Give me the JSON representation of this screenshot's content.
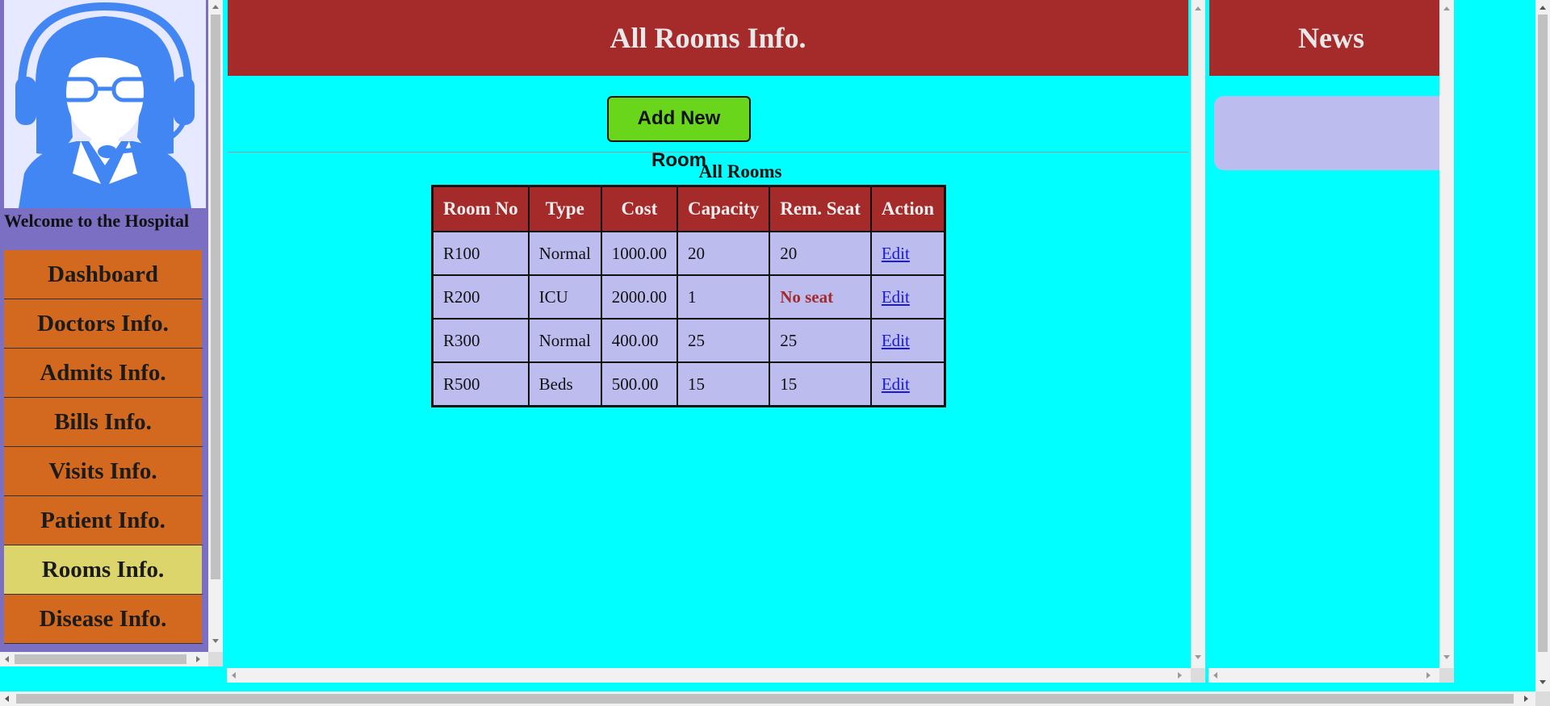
{
  "sidebar": {
    "welcome": "Welcome to the Hospital",
    "items": [
      {
        "label": "Dashboard",
        "active": false
      },
      {
        "label": "Doctors Info.",
        "active": false
      },
      {
        "label": "Admits Info.",
        "active": false
      },
      {
        "label": "Bills Info.",
        "active": false
      },
      {
        "label": "Visits Info.",
        "active": false
      },
      {
        "label": "Patient Info.",
        "active": false
      },
      {
        "label": "Rooms Info.",
        "active": true
      },
      {
        "label": "Disease Info.",
        "active": false
      }
    ]
  },
  "main": {
    "title": "All Rooms Info.",
    "add_button": "Add New Room",
    "table_caption": "All Rooms",
    "columns": [
      "Room No",
      "Type",
      "Cost",
      "Capacity",
      "Rem. Seat",
      "Action"
    ],
    "rows": [
      {
        "room": "R100",
        "type": "Normal",
        "cost": "1000.00",
        "capacity": "20",
        "seat": "20",
        "action": "Edit"
      },
      {
        "room": "R200",
        "type": "ICU",
        "cost": "2000.00",
        "capacity": "1",
        "seat": "No seat",
        "action": "Edit"
      },
      {
        "room": "R300",
        "type": "Normal",
        "cost": "400.00",
        "capacity": "25",
        "seat": "25",
        "action": "Edit"
      },
      {
        "room": "R500",
        "type": "Beds",
        "cost": "500.00",
        "capacity": "15",
        "seat": "15",
        "action": "Edit"
      }
    ]
  },
  "news": {
    "title": "News"
  },
  "colors": {
    "page_bg": "#00ffff",
    "header_bg": "#a52a2a",
    "nav_bg": "#d2691e",
    "nav_active_bg": "#dcd56c",
    "sidebar_bg": "#7b6fc4",
    "table_cell_bg": "#bcbcef",
    "button_bg": "#6ad61b",
    "no_seat_text": "#a52a2a"
  }
}
